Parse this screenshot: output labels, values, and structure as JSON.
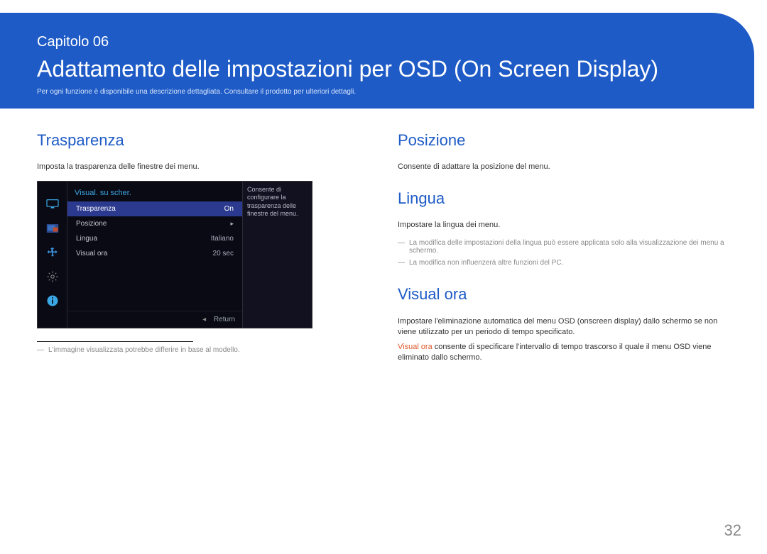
{
  "header": {
    "chapter": "Capitolo 06",
    "title": "Adattamento delle impostazioni per OSD (On Screen Display)",
    "sub": "Per ogni funzione è disponibile una descrizione dettagliata. Consultare il prodotto per ulteriori dettagli."
  },
  "left": {
    "h2": "Trasparenza",
    "desc": "Imposta la trasparenza delle finestre dei menu.",
    "footnote": "L'immagine visualizzata potrebbe differire in base al modello."
  },
  "osd": {
    "title": "Visual. su scher.",
    "help": "Consente di configurare la trasparenza delle finestre del menu.",
    "rows": [
      {
        "label": "Trasparenza",
        "value": "On",
        "selected": true
      },
      {
        "label": "Posizione",
        "value": "",
        "chev": true
      },
      {
        "label": "Lingua",
        "value": "Italiano"
      },
      {
        "label": "Visual ora",
        "value": "20 sec"
      }
    ],
    "return_tri": "◂",
    "return": "Return"
  },
  "right": {
    "posizione": {
      "h2": "Posizione",
      "desc": "Consente di adattare la posizione del menu."
    },
    "lingua": {
      "h2": "Lingua",
      "desc": "Impostare la lingua dei menu.",
      "note1": "La modifica delle impostazioni della lingua può essere applicata solo alla visualizzazione dei menu a schermo.",
      "note2": "La modifica non influenzerà altre funzioni del PC."
    },
    "visualora": {
      "h2": "Visual ora",
      "p1": "Impostare l'eliminazione automatica del menu OSD (onscreen display) dallo schermo se non viene utilizzato per un periodo di tempo specificato.",
      "p2_hl": "Visual ora",
      "p2_rest": " consente di specificare l'intervallo di tempo trascorso il quale il menu OSD viene eliminato dallo schermo."
    }
  },
  "page": "32"
}
